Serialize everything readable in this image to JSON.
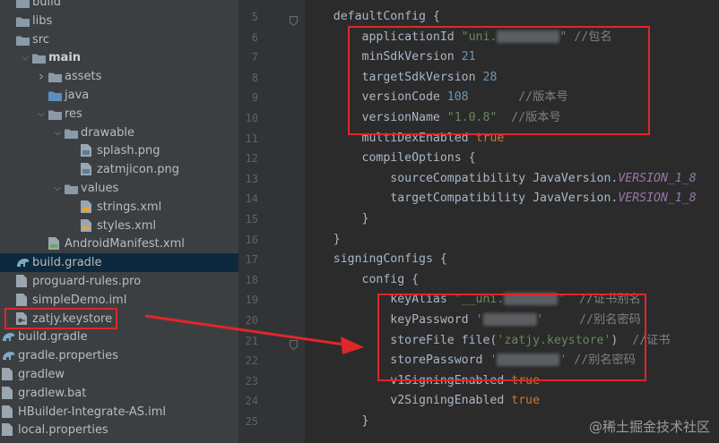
{
  "project_tree": {
    "items": [
      {
        "label": "build",
        "type": "folder",
        "indent": 0,
        "arrow": "none",
        "bold": false
      },
      {
        "label": "libs",
        "type": "folder",
        "indent": 0,
        "arrow": "none",
        "bold": false
      },
      {
        "label": "src",
        "type": "folder",
        "indent": 0,
        "arrow": "none",
        "bold": false
      },
      {
        "label": "main",
        "type": "folder",
        "indent": 1,
        "arrow": "open",
        "bold": true
      },
      {
        "label": "assets",
        "type": "folder",
        "indent": 2,
        "arrow": "closed",
        "bold": false
      },
      {
        "label": "java",
        "type": "folder-blue",
        "indent": 2,
        "arrow": "none",
        "bold": false
      },
      {
        "label": "res",
        "type": "folder",
        "indent": 2,
        "arrow": "open",
        "bold": false
      },
      {
        "label": "drawable",
        "type": "folder",
        "indent": 3,
        "arrow": "open",
        "bold": false
      },
      {
        "label": "splash.png",
        "type": "image",
        "indent": 4,
        "arrow": "none",
        "bold": false
      },
      {
        "label": "zatmjicon.png",
        "type": "image",
        "indent": 4,
        "arrow": "none",
        "bold": false
      },
      {
        "label": "values",
        "type": "folder",
        "indent": 3,
        "arrow": "open",
        "bold": false
      },
      {
        "label": "strings.xml",
        "type": "xml",
        "indent": 4,
        "arrow": "none",
        "bold": false
      },
      {
        "label": "styles.xml",
        "type": "xml",
        "indent": 4,
        "arrow": "none",
        "bold": false
      },
      {
        "label": "AndroidManifest.xml",
        "type": "manifest",
        "indent": 2,
        "arrow": "none",
        "bold": false
      },
      {
        "label": "build.gradle",
        "type": "gradle",
        "indent": 0,
        "arrow": "none",
        "bold": false,
        "selected": true
      },
      {
        "label": "proguard-rules.pro",
        "type": "file",
        "indent": 0,
        "arrow": "none",
        "bold": false
      },
      {
        "label": "simpleDemo.iml",
        "type": "file",
        "indent": 0,
        "arrow": "none",
        "bold": false
      },
      {
        "label": "zatjy.keystore",
        "type": "keystore",
        "indent": 0,
        "arrow": "none",
        "bold": false
      },
      {
        "label": "build.gradle",
        "type": "gradle",
        "indent": -1,
        "arrow": "none",
        "bold": false
      },
      {
        "label": "gradle.properties",
        "type": "gradle",
        "indent": -1,
        "arrow": "none",
        "bold": false
      },
      {
        "label": "gradlew",
        "type": "file",
        "indent": -1,
        "arrow": "none",
        "bold": false
      },
      {
        "label": "gradlew.bat",
        "type": "file",
        "indent": -1,
        "arrow": "none",
        "bold": false
      },
      {
        "label": "HBuilder-Integrate-AS.iml",
        "type": "file",
        "indent": -1,
        "arrow": "none",
        "bold": false
      },
      {
        "label": "local.properties",
        "type": "file",
        "indent": -1,
        "arrow": "none",
        "bold": false
      }
    ]
  },
  "editor": {
    "lines": [
      {
        "num": "5",
        "segs": [
          {
            "t": "    defaultConfig {",
            "c": ""
          }
        ]
      },
      {
        "num": "6",
        "segs": [
          {
            "t": "        applicationId ",
            "c": ""
          },
          {
            "t": "\"uni.",
            "c": "s"
          },
          {
            "blur": 70
          },
          {
            "t": "\"",
            "c": "s"
          },
          {
            "t": " //包名",
            "c": "c"
          }
        ]
      },
      {
        "num": "7",
        "segs": [
          {
            "t": "        minSdkVersion ",
            "c": ""
          },
          {
            "t": "21",
            "c": "n"
          }
        ]
      },
      {
        "num": "8",
        "segs": [
          {
            "t": "        targetSdkVersion ",
            "c": ""
          },
          {
            "t": "28",
            "c": "n"
          }
        ]
      },
      {
        "num": "9",
        "segs": [
          {
            "t": "        versionCode ",
            "c": ""
          },
          {
            "t": "108",
            "c": "n"
          },
          {
            "t": "       //版本号",
            "c": "c"
          }
        ]
      },
      {
        "num": "10",
        "segs": [
          {
            "t": "        versionName ",
            "c": ""
          },
          {
            "t": "\"1.0.8\"",
            "c": "s"
          },
          {
            "t": "  //版本号",
            "c": "c"
          }
        ]
      },
      {
        "num": "11",
        "segs": [
          {
            "t": "        multiDexEnabled ",
            "c": ""
          },
          {
            "t": "true",
            "c": "k"
          }
        ]
      },
      {
        "num": "12",
        "segs": [
          {
            "t": "        compileOptions {",
            "c": ""
          }
        ]
      },
      {
        "num": "13",
        "segs": [
          {
            "t": "            sourceCompatibility JavaVersion.",
            "c": ""
          },
          {
            "t": "VERSION_1_8",
            "c": "f"
          }
        ]
      },
      {
        "num": "14",
        "segs": [
          {
            "t": "            targetCompatibility JavaVersion.",
            "c": ""
          },
          {
            "t": "VERSION_1_8",
            "c": "f"
          }
        ]
      },
      {
        "num": "15",
        "segs": [
          {
            "t": "        }",
            "c": ""
          }
        ]
      },
      {
        "num": "16",
        "segs": [
          {
            "t": "    }",
            "c": ""
          }
        ]
      },
      {
        "num": "17",
        "segs": [
          {
            "t": "    signingConfigs {",
            "c": ""
          }
        ]
      },
      {
        "num": "18",
        "segs": [
          {
            "t": "        config {",
            "c": ""
          }
        ]
      },
      {
        "num": "19",
        "segs": [
          {
            "t": "            keyAlias ",
            "c": ""
          },
          {
            "t": "'__uni.",
            "c": "s"
          },
          {
            "blur": 60
          },
          {
            "t": "'",
            "c": "s"
          },
          {
            "t": "  //证书别名",
            "c": "c"
          }
        ]
      },
      {
        "num": "20",
        "segs": [
          {
            "t": "            keyPassword ",
            "c": ""
          },
          {
            "t": "'",
            "c": "s"
          },
          {
            "blur": 60
          },
          {
            "t": "'",
            "c": "s"
          },
          {
            "t": "     //别名密码",
            "c": "c"
          }
        ]
      },
      {
        "num": "21",
        "segs": [
          {
            "t": "            storeFile file(",
            "c": ""
          },
          {
            "t": "'zatjy.keystore'",
            "c": "s"
          },
          {
            "t": ")  ",
            "c": ""
          },
          {
            "t": "//证书",
            "c": "c"
          }
        ]
      },
      {
        "num": "22",
        "segs": [
          {
            "t": "            storePassword ",
            "c": ""
          },
          {
            "t": "'",
            "c": "s"
          },
          {
            "blur": 70
          },
          {
            "t": "'",
            "c": "s"
          },
          {
            "t": " //别名密码",
            "c": "c"
          }
        ]
      },
      {
        "num": "23",
        "segs": [
          {
            "t": "            v1SigningEnabled ",
            "c": ""
          },
          {
            "t": "true",
            "c": "k"
          }
        ]
      },
      {
        "num": "24",
        "segs": [
          {
            "t": "            v2SigningEnabled ",
            "c": ""
          },
          {
            "t": "true",
            "c": "k"
          }
        ]
      },
      {
        "num": "25",
        "segs": [
          {
            "t": "        }",
            "c": ""
          }
        ]
      }
    ]
  },
  "colors": {
    "highlight_box": "#e0262b",
    "arrow": "#e0262b"
  },
  "watermark": "@稀土掘金技术社区"
}
